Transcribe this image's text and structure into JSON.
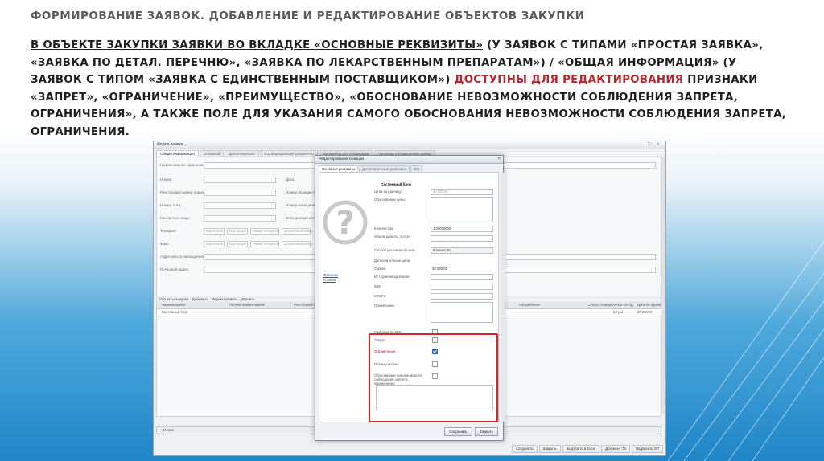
{
  "slide": {
    "title": "ФОРМИРОВАНИЕ ЗАЯВОК. ДОБАВЛЕНИЕ И РЕДАКТИРОВАНИЕ ОБЪЕКТОВ ЗАКУПКИ",
    "body_underlined": "В ОБЪЕКТЕ ЗАКУПКИ ЗАЯВКИ ВО ВКЛАДКЕ «ОСНОВНЫЕ РЕКВИЗИТЫ»",
    "body_part1": " (У ЗАЯВОК С ТИПАМИ «ПРОСТАЯ ЗАЯВКА», «ЗАЯВКА ПО ДЕТАЛ. ПЕРЕЧНЮ», «ЗАЯВКА ПО ЛЕКАРСТВЕННЫМ ПРЕПАРАТАМ») / «ОБЩАЯ ИНФОРМАЦИЯ» (У ЗАЯВОК С ТИПОМ «ЗАЯВКА С ЕДИНСТВЕННЫМ ПОСТАВЩИКОМ») ",
    "body_highlight": "ДОСТУПНЫ ДЛЯ РЕДАКТИРОВАНИЯ",
    "body_part2": " ПРИЗНАКИ «ЗАПРЕТ», «ОГРАНИЧЕНИЕ», «ПРЕИМУЩЕСТВО», «ОБОСНОВАНИЕ НЕВОЗМОЖНОСТИ СОБЛЮДЕНИЯ ЗАПРЕТА, ОГРАНИЧЕНИЯ», А ТАКЖЕ ПОЛЕ ДЛЯ УКАЗАНИЯ САМОГО ОБОСНОВАНИЯ НЕВОЗМОЖНОСТИ СОБЛЮДЕНИЯ ЗАПРЕТА, ОГРАНИЧЕНИЯ.",
    "highlight_color": "#b8262c"
  },
  "window": {
    "title": "Форма заявки",
    "tabs": [
      "Общая информация",
      "Основной",
      "Дополнительно",
      "Подтверждающие документы",
      "Документы для публикации",
      "Признаки к размещению заявки"
    ],
    "fields": {
      "org": "Наименование организации:",
      "number": "Номер:",
      "date": "Дата:",
      "reg_number": "Реестровый номер плана-графика:",
      "position_number": "Номер позиции в плане-графике:",
      "lot_number": "Номер лота:",
      "notice_number": "Номер извещения:",
      "contact": "Контактное лицо:",
      "email": "Электронная почта:",
      "phone": "Телефон:",
      "fax": "Факс:",
      "location": "Адрес места нахождения:",
      "postal": "Почтовый адрес:"
    },
    "phone_parts": [
      "Код страны",
      "Код города",
      "Номер телефона",
      "Добавочный номер"
    ],
    "toolbar": {
      "title": "Объекты закупки",
      "add": "Добавить",
      "edit": "Редактировать",
      "delete": "Удалить"
    },
    "table_headers": [
      "Наименование",
      "Полное наименование",
      "Реестровый номер",
      "Направление",
      "Статус позиции",
      "ОКЕИ",
      "ОКПД",
      "Цена за единицу"
    ],
    "table_row": {
      "name": "Системный блок",
      "col_unit": "Штука",
      "col_price": "20 000,00"
    },
    "footer_label": "Итого:",
    "bottom_buttons": [
      "Сохранить",
      "Закрыть",
      "Выгрузить в Excel",
      "Документ 73",
      "Подписать ЭП"
    ]
  },
  "modal": {
    "title": "Редактирование позиции",
    "tabs": [
      "Основные реквизиты",
      "Дополнительные реквизиты",
      "КБК"
    ],
    "block_title": "Системный блок",
    "links": [
      "Описание",
      "Условия"
    ],
    "labels": {
      "price": "Цена за единицу:",
      "price_basis": "Обоснование цены:",
      "quantity": "Количество:",
      "volume": "Объем работы, услуги:",
      "volume_method": "Способ указания объема:",
      "additional_price": "Дополнительная цена:",
      "sum": "Сумма:",
      "funding": "Ист. финансирования:",
      "kbk": "КБК:",
      "kosgu": "КОСГУ:",
      "note": "Примечание:",
      "kbk_split": "Разбивка по КБК:",
      "ban": "Запрет:",
      "restriction": "Ограничение:",
      "advantage": "Преимущество:",
      "justification": "Обоснование невозможности соблюдения запрета, ограничения:"
    },
    "values": {
      "price": "20 000,00",
      "quantity": "1,00000000",
      "volume_method": "Количество",
      "sum": "20 000,00"
    },
    "checks": {
      "kbk_split": false,
      "ban": false,
      "restriction": true,
      "advantage": false,
      "justification": false
    },
    "buttons": {
      "save": "Сохранить",
      "close": "Закрыть"
    }
  }
}
